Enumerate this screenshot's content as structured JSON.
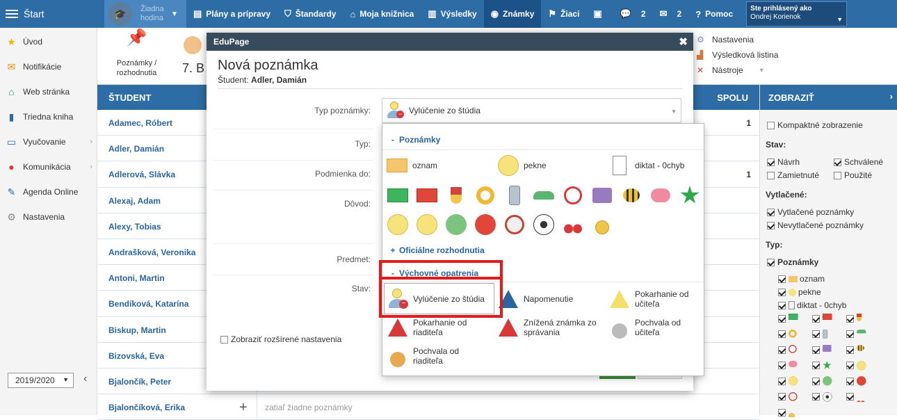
{
  "topbar": {
    "start_label": "Štart",
    "hour_selector": "Žiadna hodina",
    "nav": [
      {
        "label": "Plány a prípravy",
        "icon": "folder-icon",
        "active": false,
        "count": ""
      },
      {
        "label": "Štandardy",
        "icon": "shield-icon",
        "active": false,
        "count": ""
      },
      {
        "label": "Moja knižnica",
        "icon": "library-icon",
        "active": false,
        "count": ""
      },
      {
        "label": "Výsledky",
        "icon": "bar-chart-icon",
        "active": false,
        "count": ""
      },
      {
        "label": "Známky",
        "icon": "grades-icon",
        "active": true,
        "count": ""
      },
      {
        "label": "Žiaci",
        "icon": "students-icon",
        "active": false,
        "count": ""
      },
      {
        "label": "",
        "icon": "cast-icon",
        "active": false,
        "count": ""
      },
      {
        "label": "",
        "icon": "chat-icon",
        "active": false,
        "count": "2"
      },
      {
        "label": "",
        "icon": "mail-icon",
        "active": false,
        "count": "2"
      },
      {
        "label": "Pomoc",
        "icon": "help-icon",
        "active": false,
        "count": ""
      }
    ],
    "user_caption": "Ste prihlásený ako",
    "user_name": "Ondrej Korienok"
  },
  "sidebar": {
    "items": [
      {
        "label": "Úvod",
        "icon": "star-icon",
        "color": "#f0b500",
        "arrow": false
      },
      {
        "label": "Notifikácie",
        "icon": "envelope-icon",
        "color": "#f08a00",
        "arrow": false
      },
      {
        "label": "Web stránka",
        "icon": "home-icon",
        "color": "#2a9a6a",
        "arrow": false
      },
      {
        "label": "Triedna kniha",
        "icon": "book-icon",
        "color": "#2e6ca5",
        "arrow": false
      },
      {
        "label": "Vyučovanie",
        "icon": "open-book-icon",
        "color": "#2e6ca5",
        "arrow": true
      },
      {
        "label": "Komunikácia",
        "icon": "chat-bubbles-icon",
        "color": "#d9383a",
        "arrow": true
      },
      {
        "label": "Agenda Online",
        "icon": "pen-icon",
        "color": "#2e6ca5",
        "arrow": false
      },
      {
        "label": "Nastavenia",
        "icon": "gear-icon",
        "color": "#888888",
        "arrow": false
      }
    ],
    "year": "2019/2020",
    "collapse_symbol": "‹"
  },
  "ribbon": {
    "notes_button": "Poznámky / rozhodnutia",
    "class_label": "7. B",
    "right_links": [
      "Nastavenia",
      "Výsledková listina",
      "Nástroje"
    ]
  },
  "table": {
    "col_student": "ŠTUDENT",
    "col_total": "SPOLU",
    "empty_text": "zatiaľ žiadne poznámky",
    "rows": [
      {
        "name": "Adamec, Róbert",
        "total": "1"
      },
      {
        "name": "Adler, Damián",
        "total": ""
      },
      {
        "name": "Adlerová, Slávka",
        "total": "1"
      },
      {
        "name": "Alexaj, Adam",
        "total": ""
      },
      {
        "name": "Alexy, Tobias",
        "total": ""
      },
      {
        "name": "Andrašková, Veronika",
        "total": ""
      },
      {
        "name": "Antoni, Martin",
        "total": ""
      },
      {
        "name": "Bendíková, Katarína",
        "total": ""
      },
      {
        "name": "Biskup, Martin",
        "total": ""
      },
      {
        "name": "Bizovská, Eva",
        "total": ""
      },
      {
        "name": "Bjalončík, Peter",
        "total": ""
      },
      {
        "name": "Bjalončíková, Erika",
        "total": ""
      }
    ]
  },
  "right_panel": {
    "title": "ZOBRAZIŤ",
    "compact": "Kompaktné zobrazenie",
    "state_title": "Stav:",
    "states": [
      {
        "label": "Návrh",
        "checked": true
      },
      {
        "label": "Schválené",
        "checked": true
      },
      {
        "label": "Zamietnuté",
        "checked": false
      },
      {
        "label": "Použité",
        "checked": false
      }
    ],
    "printed_title": "Vytlačené:",
    "printed": [
      {
        "label": "Vytlačené poznámky",
        "checked": true
      },
      {
        "label": "Nevytlačené poznámky",
        "checked": true
      }
    ],
    "type_title": "Typ:",
    "type_group": "Poznámky",
    "type_items": [
      "oznam",
      "pekne",
      "diktat - 0chyb"
    ]
  },
  "modal": {
    "window_title": "EduPage",
    "close_symbol": "✖",
    "heading": "Nová poznámka",
    "student_prefix": "Študent:",
    "student_name": "Adler, Damián",
    "labels": {
      "type_note": "Typ poznámky:",
      "type": "Typ:",
      "condition": "Podmienka do:",
      "reason": "Dôvod:",
      "subject": "Predmet:",
      "state": "Stav:"
    },
    "selected_type": "Vylúčenie zo štúdia",
    "advanced": "Zobraziť rozšírené nastavenia"
  },
  "dropdown": {
    "sections": [
      {
        "sign": "-",
        "title": "Poznámky"
      },
      {
        "sign": "+",
        "title": "Oficiálne rozhodnutia"
      },
      {
        "sign": "-",
        "title": "Výchovné opatrenia"
      }
    ],
    "notes": [
      {
        "label": "oznam",
        "icon": "envelope-icon"
      },
      {
        "label": "pekne",
        "icon": "smiley-icon"
      },
      {
        "label": "diktat - 0chyb",
        "icon": "document-pen-icon"
      }
    ],
    "icon_grid": [
      "green-envelope-icon",
      "red-envelope-icon",
      "medal-star-icon",
      "key-icon",
      "phone-icon",
      "shoe-icon",
      "alarm-clock-icon",
      "bag-icon",
      "bee-icon",
      "pig-icon",
      "green-star-icon",
      "sad-face-icon",
      "neutral-face-icon",
      "plus-circle-icon",
      "minus-circle-icon",
      "euro-coin-icon",
      "football-icon",
      "cherries-icon",
      "gold-medal-icon"
    ],
    "measures": [
      {
        "label": "Vylúčenie zo štúdia",
        "icon": "user-minus-icon",
        "color": "#d9383a"
      },
      {
        "label": "Napomenutie",
        "icon": "warning-blue-icon",
        "color": "#2a65a0"
      },
      {
        "label": "Pokarhanie od učiteľa",
        "icon": "warning-yellow-icon",
        "color": "#f3e06a"
      },
      {
        "label": "Pokarhanie od riaditeľa",
        "icon": "warning-red-icon",
        "color": "#d9383a"
      },
      {
        "label": "Znížená známka zo správania",
        "icon": "warning-grade-icon",
        "color": "#d9383a"
      },
      {
        "label": "Pochvala od učiteľa",
        "icon": "silver-medal-icon",
        "color": "#bbbbbb"
      },
      {
        "label": "Pochvala od riaditeľa",
        "icon": "bronze-medal-icon",
        "color": "#e9a850"
      }
    ]
  }
}
